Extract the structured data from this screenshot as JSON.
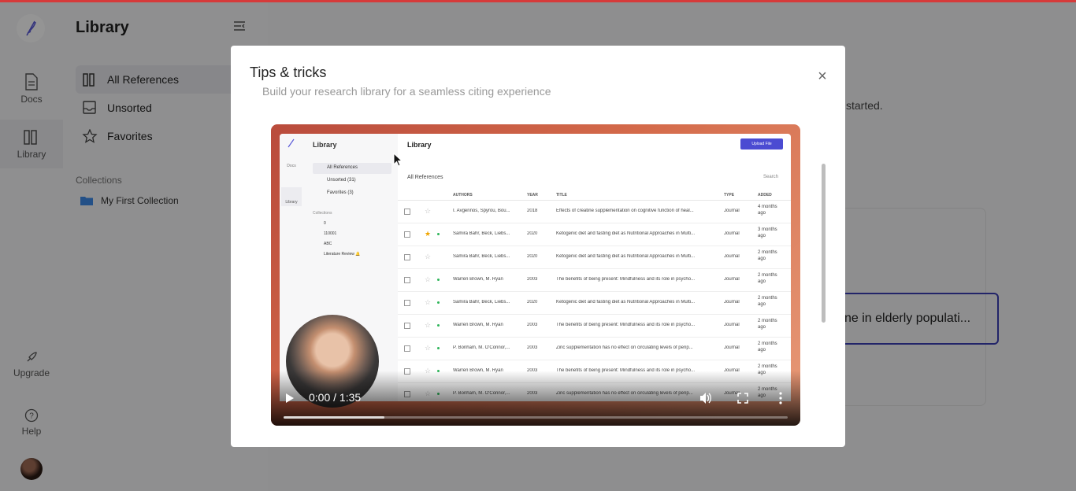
{
  "rail": {
    "items": [
      {
        "label": "Docs",
        "icon": "document-icon"
      },
      {
        "label": "Library",
        "icon": "books-icon",
        "active": true
      },
      {
        "label": "Upgrade",
        "icon": "rocket-icon"
      },
      {
        "label": "Help",
        "icon": "help-icon"
      }
    ]
  },
  "sidebar": {
    "title": "Library",
    "nav": [
      {
        "label": "All References",
        "icon": "books-icon",
        "active": true
      },
      {
        "label": "Unsorted",
        "icon": "inbox-icon"
      },
      {
        "label": "Favorites",
        "icon": "star-icon"
      }
    ],
    "collections_label": "Collections",
    "collections": [
      {
        "label": "My First Collection",
        "icon": "folder-icon"
      }
    ]
  },
  "background": {
    "partial_text": "started.",
    "partial_box_text": "ne in elderly populati..."
  },
  "modal": {
    "title": "Tips & tricks",
    "subtitle": "Build your research library for a seamless citing experience",
    "close": "×"
  },
  "video": {
    "time": "0:00 / 1:35",
    "progress": 0.2,
    "inner": {
      "side_title": "Library",
      "docs": "Docs",
      "library": "Library",
      "nav": [
        "All References",
        "Unsorted (31)",
        "Favorites (3)"
      ],
      "collections_label": "Collections",
      "collections": [
        "0",
        "110001",
        "ABC",
        "Literature Review 🔔"
      ],
      "main_title": "Library",
      "upload": "Upload File",
      "tab": "All References",
      "search": "Search",
      "headers": [
        "AUTHORS",
        "YEAR",
        "TITLE",
        "TYPE",
        "ADDED"
      ],
      "rows": [
        {
          "authors": "I. Avgerinos, Spyrou, Bou...",
          "year": "2018",
          "title": "Effects of creatine supplementation on cognitive function of heal...",
          "type": "Journal",
          "added": "4 months ago",
          "fav": false,
          "dot": false
        },
        {
          "authors": "Samira Bahr, Beck, Liebs...",
          "year": "2020",
          "title": "Ketogenic diet and fasting diet as Nutritional Approaches in Multi...",
          "type": "Journal",
          "added": "3 months ago",
          "fav": true,
          "dot": true
        },
        {
          "authors": "Samira Bahr, Beck, Liebs...",
          "year": "2020",
          "title": "Ketogenic diet and fasting diet as Nutritional Approaches in Multi...",
          "type": "Journal",
          "added": "2 months ago",
          "fav": false,
          "dot": false
        },
        {
          "authors": "Warren Brown, M. Ryan",
          "year": "2003",
          "title": "The benefits of being present: Mindfulness and its role in psycho...",
          "type": "Journal",
          "added": "2 months ago",
          "fav": false,
          "dot": true
        },
        {
          "authors": "Samira Bahr, Beck, Liebs...",
          "year": "2020",
          "title": "Ketogenic diet and fasting diet as Nutritional Approaches in Multi...",
          "type": "Journal",
          "added": "2 months ago",
          "fav": false,
          "dot": true
        },
        {
          "authors": "Warren Brown, M. Ryan",
          "year": "2003",
          "title": "The benefits of being present: Mindfulness and its role in psycho...",
          "type": "Journal",
          "added": "2 months ago",
          "fav": false,
          "dot": true
        },
        {
          "authors": "P. Bonham, M. O'Connor,...",
          "year": "2003",
          "title": "Zinc supplementation has no effect on circulating levels of perip...",
          "type": "Journal",
          "added": "2 months ago",
          "fav": false,
          "dot": true
        },
        {
          "authors": "Warren Brown, M. Ryan",
          "year": "2003",
          "title": "The benefits of being present: Mindfulness and its role in psycho...",
          "type": "Journal",
          "added": "2 months ago",
          "fav": false,
          "dot": true
        },
        {
          "authors": "P. Bonham, M. O'Connor,...",
          "year": "2003",
          "title": "Zinc supplementation has no effect on circulating levels of perip...",
          "type": "Journal",
          "added": "2 months ago",
          "fav": false,
          "dot": true
        }
      ]
    }
  }
}
